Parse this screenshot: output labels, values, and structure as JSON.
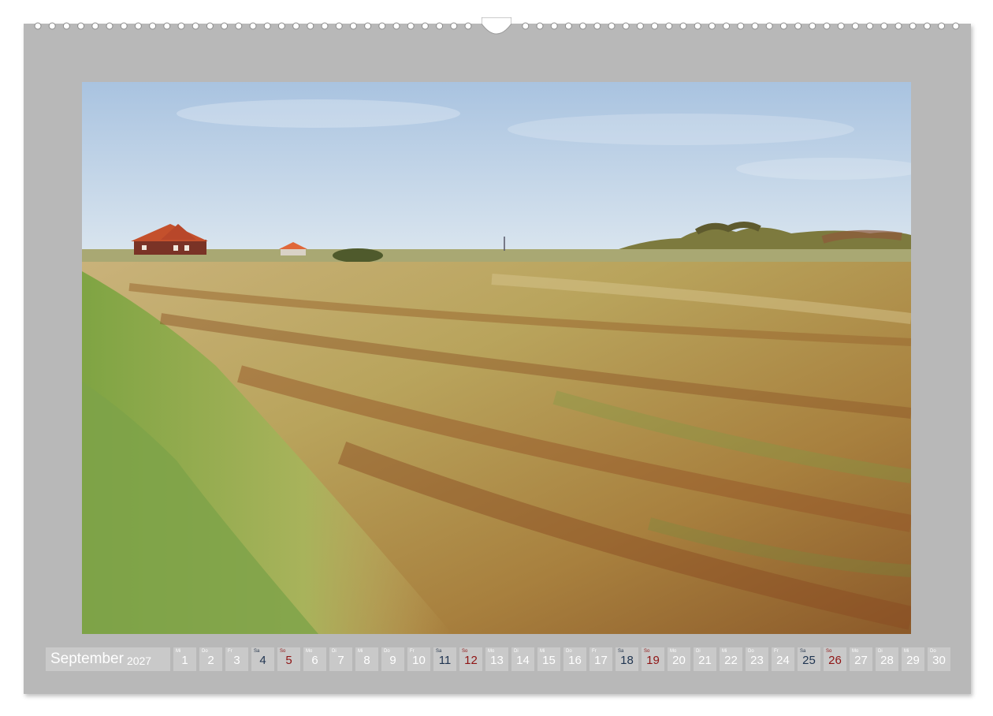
{
  "calendar": {
    "month": "September",
    "year": "2027",
    "colors": {
      "sheet": "#b8b8b8",
      "cell": "#c9c9c9",
      "weekday_text": "#ffffff",
      "saturday_text": "#1f3450",
      "sunday_text": "#8f1414"
    },
    "days": [
      {
        "abbr": "Mi",
        "num": "1",
        "kind": "weekday"
      },
      {
        "abbr": "Do",
        "num": "2",
        "kind": "weekday"
      },
      {
        "abbr": "Fr",
        "num": "3",
        "kind": "weekday"
      },
      {
        "abbr": "Sa",
        "num": "4",
        "kind": "sat"
      },
      {
        "abbr": "So",
        "num": "5",
        "kind": "sun"
      },
      {
        "abbr": "Mo",
        "num": "6",
        "kind": "weekday"
      },
      {
        "abbr": "Di",
        "num": "7",
        "kind": "weekday"
      },
      {
        "abbr": "Mi",
        "num": "8",
        "kind": "weekday"
      },
      {
        "abbr": "Do",
        "num": "9",
        "kind": "weekday"
      },
      {
        "abbr": "Fr",
        "num": "10",
        "kind": "weekday"
      },
      {
        "abbr": "Sa",
        "num": "11",
        "kind": "sat"
      },
      {
        "abbr": "So",
        "num": "12",
        "kind": "sun"
      },
      {
        "abbr": "Mo",
        "num": "13",
        "kind": "weekday"
      },
      {
        "abbr": "Di",
        "num": "14",
        "kind": "weekday"
      },
      {
        "abbr": "Mi",
        "num": "15",
        "kind": "weekday"
      },
      {
        "abbr": "Do",
        "num": "16",
        "kind": "weekday"
      },
      {
        "abbr": "Fr",
        "num": "17",
        "kind": "weekday"
      },
      {
        "abbr": "Sa",
        "num": "18",
        "kind": "sat"
      },
      {
        "abbr": "So",
        "num": "19",
        "kind": "sun"
      },
      {
        "abbr": "Mo",
        "num": "20",
        "kind": "weekday"
      },
      {
        "abbr": "Di",
        "num": "21",
        "kind": "weekday"
      },
      {
        "abbr": "Mi",
        "num": "22",
        "kind": "weekday"
      },
      {
        "abbr": "Do",
        "num": "23",
        "kind": "weekday"
      },
      {
        "abbr": "Fr",
        "num": "24",
        "kind": "weekday"
      },
      {
        "abbr": "Sa",
        "num": "25",
        "kind": "sat"
      },
      {
        "abbr": "So",
        "num": "26",
        "kind": "sun"
      },
      {
        "abbr": "Mo",
        "num": "27",
        "kind": "weekday"
      },
      {
        "abbr": "Di",
        "num": "28",
        "kind": "weekday"
      },
      {
        "abbr": "Mi",
        "num": "29",
        "kind": "weekday"
      },
      {
        "abbr": "Do",
        "num": "30",
        "kind": "weekday"
      }
    ]
  },
  "photo": {
    "subject": "dune-meadow-with-red-brick-house",
    "colors": {
      "sky_top": "#a9c3e0",
      "sky_bottom": "#dbe6ef",
      "grass_green": "#86a44a",
      "grass_gold": "#c9a85e",
      "grass_rust": "#a9602b",
      "roof": "#c4502c"
    }
  }
}
